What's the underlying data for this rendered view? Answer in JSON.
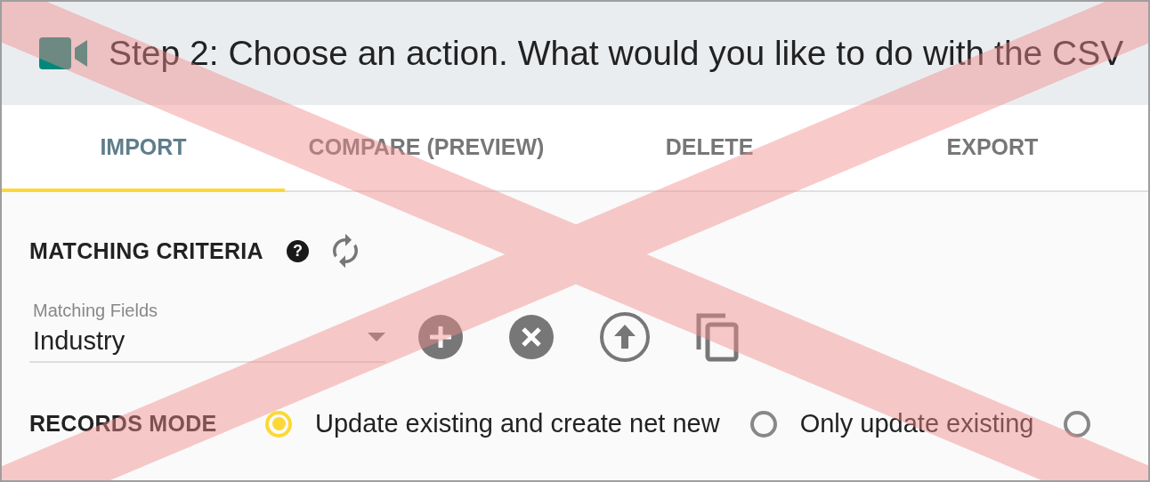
{
  "header": {
    "title": "Step 2: Choose an action. What would you like to do with the CSV"
  },
  "tabs": [
    {
      "label": "IMPORT",
      "selected": true
    },
    {
      "label": "COMPARE (PREVIEW)",
      "selected": false
    },
    {
      "label": "DELETE",
      "selected": false
    },
    {
      "label": "EXPORT",
      "selected": false
    }
  ],
  "matching_criteria": {
    "heading": "MATCHING CRITERIA",
    "help_icon": "?",
    "field": {
      "label": "Matching Fields",
      "value": "Industry"
    }
  },
  "records_mode": {
    "heading": "RECORDS MODE",
    "options": [
      {
        "label": "Update existing and create net new",
        "selected": true
      },
      {
        "label": "Only update existing",
        "selected": false
      },
      {
        "selected": false
      }
    ]
  }
}
